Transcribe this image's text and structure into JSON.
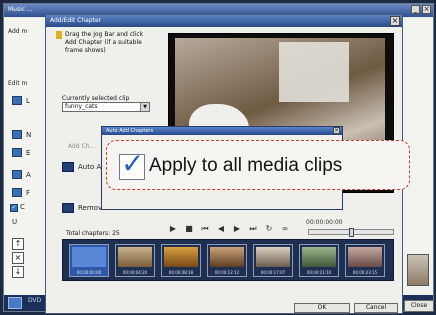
{
  "main_window": {
    "title": "Add/Edit Chapter",
    "app_title": "Music ...",
    "left_panel": {
      "add_text": "Add m",
      "edit_text": "Edit m",
      "letters": [
        "L",
        "N",
        "E",
        "A",
        "F"
      ],
      "option_c": "C",
      "option_u": "U"
    },
    "taskbar_label": "DVD"
  },
  "dialog": {
    "title": "Add/Edit Chapter",
    "instruction": "Drag the Jog Bar and click Add Chapter (if a suitable frame shows)",
    "clip_label": "Currently selected clip",
    "clip_value": "funny_cats",
    "side_buttons": [
      "Add Ch...",
      "Auto Add",
      "",
      "Remove"
    ],
    "total_label": "Total chapters:",
    "total_value": "25",
    "timecode": "00:00:00:00",
    "thumbnails": [
      {
        "time": "00:00:00:00"
      },
      {
        "time": "00:00:04:20"
      },
      {
        "time": "00:00:08:18"
      },
      {
        "time": "00:00:12:12"
      },
      {
        "time": "00:00:17:07"
      },
      {
        "time": "00:00:21:10"
      },
      {
        "time": "00:00:23:15"
      }
    ],
    "ok_label": "OK",
    "cancel_label": "Cancel",
    "close_label": "Close"
  },
  "auto_dialog": {
    "title": "Auto Add Chapters",
    "checkbox_label": "Apply to all media clips",
    "checkbox_checked": true
  }
}
